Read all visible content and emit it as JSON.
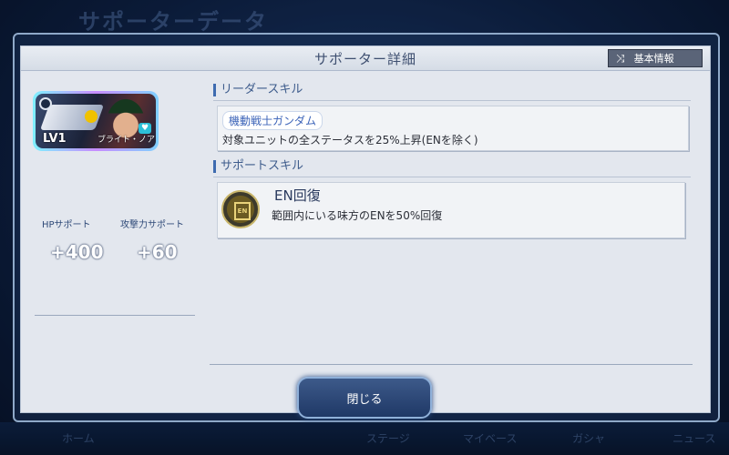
{
  "background": {
    "title": "サポーターデータ",
    "nav": [
      "ホーム",
      "ステージ",
      "マイベース",
      "ガシャ",
      "ニュース"
    ]
  },
  "dialog": {
    "title": "サポーター詳細",
    "basic_info_label": "基本情報",
    "close_label": "閉じる"
  },
  "supporter": {
    "level": "LV1",
    "name": "ブライト・ノア",
    "hp_label": "HPサポート",
    "hp_value": "+400",
    "atk_label": "攻撃力サポート",
    "atk_value": "+60"
  },
  "leader_skill": {
    "section_title": "リーダースキル",
    "condition": "機動戦士ガンダム",
    "description": "対象ユニットの全ステータスを25%上昇(ENを除く)"
  },
  "support_skill": {
    "section_title": "サポートスキル",
    "icon_text": "EN",
    "name": "EN回復",
    "description": "範囲内にいる味方のENを50%回復"
  },
  "colors": {
    "accent": "#3e6bb0",
    "panel": "#e3e7ee",
    "frame": "#8fa9c9"
  }
}
